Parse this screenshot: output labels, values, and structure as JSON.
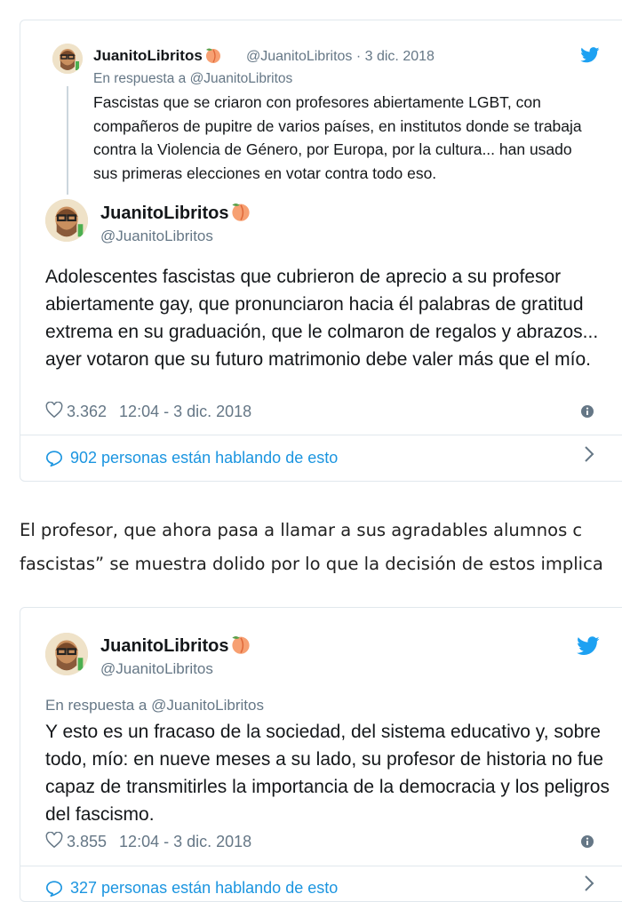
{
  "colors": {
    "twitter_blue": "#1da1f2",
    "link_blue": "#1b95e0",
    "muted": "#657786",
    "border": "#e1e8ed"
  },
  "tweet1": {
    "quoted": {
      "name": "JuanitoLibritos",
      "handle_date": "@JuanitoLibritos · 3 dic. 2018",
      "reply_to": "En respuesta a @JuanitoLibritos",
      "text": "Fascistas que se criaron con profesores abiertamente LGBT, con compañeros de pupitre de varios países, en institutos donde se trabaja contra la Violencia de Género, por Europa, por la cultura... han usado sus primeras elecciones en votar contra todo eso."
    },
    "author_name": "JuanitoLibritos",
    "author_handle": "@JuanitoLibritos",
    "text": "Adolescentes fascistas que cubrieron de aprecio a su profesor abiertamente gay, que pronunciaron hacia él palabras de gratitud extrema en su graduación, que le colmaron de regalos y abrazos... ayer votaron que su futuro matrimonio debe valer más que el mío.",
    "likes": "3.362",
    "timestamp": "12:04 - 3 dic. 2018",
    "conversation": "902 personas están hablando de esto"
  },
  "article": {
    "line1": "El profesor, que ahora pasa a llamar a sus agradables alumnos c",
    "line2": "fascistas” se muestra dolido por lo que la decisión de estos implica"
  },
  "tweet2": {
    "author_name": "JuanitoLibritos",
    "author_handle": "@JuanitoLibritos",
    "reply_to": "En respuesta a @JuanitoLibritos",
    "text": "Y esto es un fracaso de la sociedad, del sistema educativo y, sobre todo, mío: en nueve meses a su lado, su profesor de historia no fue capaz de transmitirles la importancia de la democracia y los peligros del fascismo.",
    "likes": "3.855",
    "timestamp": "12:04 - 3 dic. 2018",
    "conversation": "327 personas están hablando de esto"
  }
}
